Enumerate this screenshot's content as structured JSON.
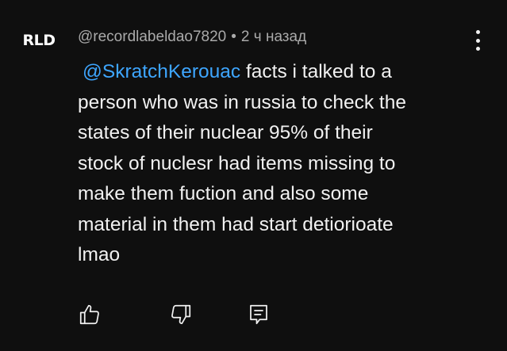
{
  "comment": {
    "avatar_text": "RLD",
    "author": "@recordlabeldao7820",
    "separator": "•",
    "time": "2 ч назад",
    "mention": "@SkratchKerouac",
    "text": " facts i talked to a\nperson who was in russia to check the\nstates of their nuclear 95% of their\nstock of nuclesr had items missing to\nmake them fuction and also some\nmaterial in them had start detiorioate\nlmao"
  },
  "icons": {
    "like": "thumbs-up-icon",
    "dislike": "thumbs-down-icon",
    "reply": "reply-icon",
    "menu": "more-vert-icon"
  },
  "colors": {
    "background": "#0f0f0f",
    "text": "#f1f1f1",
    "meta": "#aaaaaa",
    "mention": "#3ea6ff"
  }
}
